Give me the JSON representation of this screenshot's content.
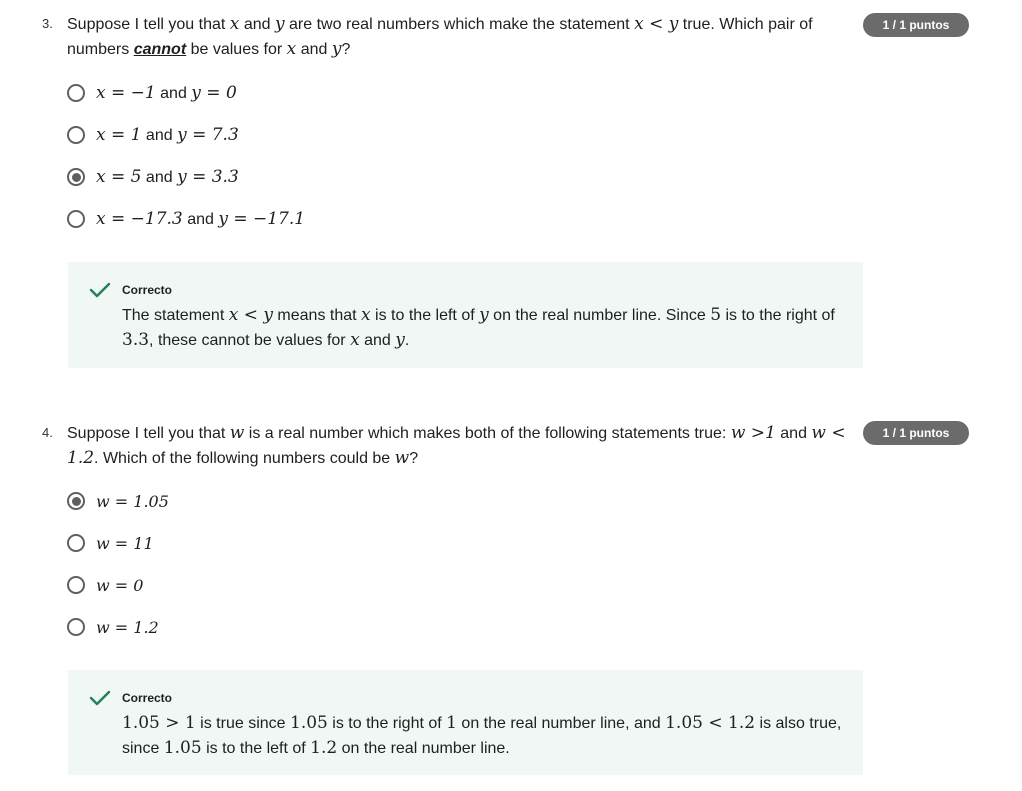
{
  "question3": {
    "number": "3.",
    "points": "1 / 1 puntos",
    "text_1": "Suppose I tell you that ",
    "x": "x",
    "and": " and ",
    "y": "y",
    "text_2": " are two real numbers which make the statement ",
    "stmt": "x < y",
    "text_3": " true. Which pair of numbers ",
    "cannot": "cannot",
    "text_4": " be values for ",
    "text_5": "?",
    "options": [
      {
        "a": "x = −1",
        "b": "y = 0",
        "checked": false
      },
      {
        "a": "x = 1",
        "b": "y = 7.3",
        "checked": false
      },
      {
        "a": "x = 5",
        "b": "y = 3.3",
        "checked": true
      },
      {
        "a": "x = −17.3",
        "b": "y = −17.1",
        "checked": false
      }
    ],
    "option_and": " and ",
    "feedback": {
      "title": "Correcto",
      "t1": "The statement ",
      "m1": "x < y",
      "t2": " means that ",
      "m2": "x",
      "t3": " is to the left of ",
      "m3": "y",
      "t4": " on the real number line. Since ",
      "m4": "5",
      "t5": " is to the right of ",
      "m5": "3.3",
      "t6": ", these cannot be values for ",
      "m6": "x",
      "t7": " and ",
      "m7": "y",
      "t8": "."
    }
  },
  "question4": {
    "number": "4.",
    "points": "1 / 1 puntos",
    "text_1": "Suppose I tell you that ",
    "w": "w",
    "text_2": " is a real number which makes both of the following statements true: ",
    "s1": "w >1",
    "and": " and ",
    "s2": "w < 1.2",
    "text_3": ". Which of the following numbers could be ",
    "text_4": "?",
    "options": [
      {
        "label": "w = 1.05",
        "checked": true
      },
      {
        "label": "w = 11",
        "checked": false
      },
      {
        "label": "w = 0",
        "checked": false
      },
      {
        "label": "w = 1.2",
        "checked": false
      }
    ],
    "feedback": {
      "title": "Correcto",
      "m1": "1.05 > 1",
      "t1": " is true since ",
      "m2": "1.05",
      "t2": " is to the right of ",
      "m3": "1",
      "t3": " on the real number line, and ",
      "m4": "1.05 < 1.2",
      "t4": " is also true, since ",
      "m5": "1.05",
      "t5": " is to the left of ",
      "m6": "1.2",
      "t6": " on the real number line."
    }
  },
  "colors": {
    "badge_bg": "#6b6b6b",
    "feedback_bg": "#f1f7f4",
    "check_green": "#1f8354"
  },
  "icons": [
    "radio-icon",
    "check-icon"
  ]
}
